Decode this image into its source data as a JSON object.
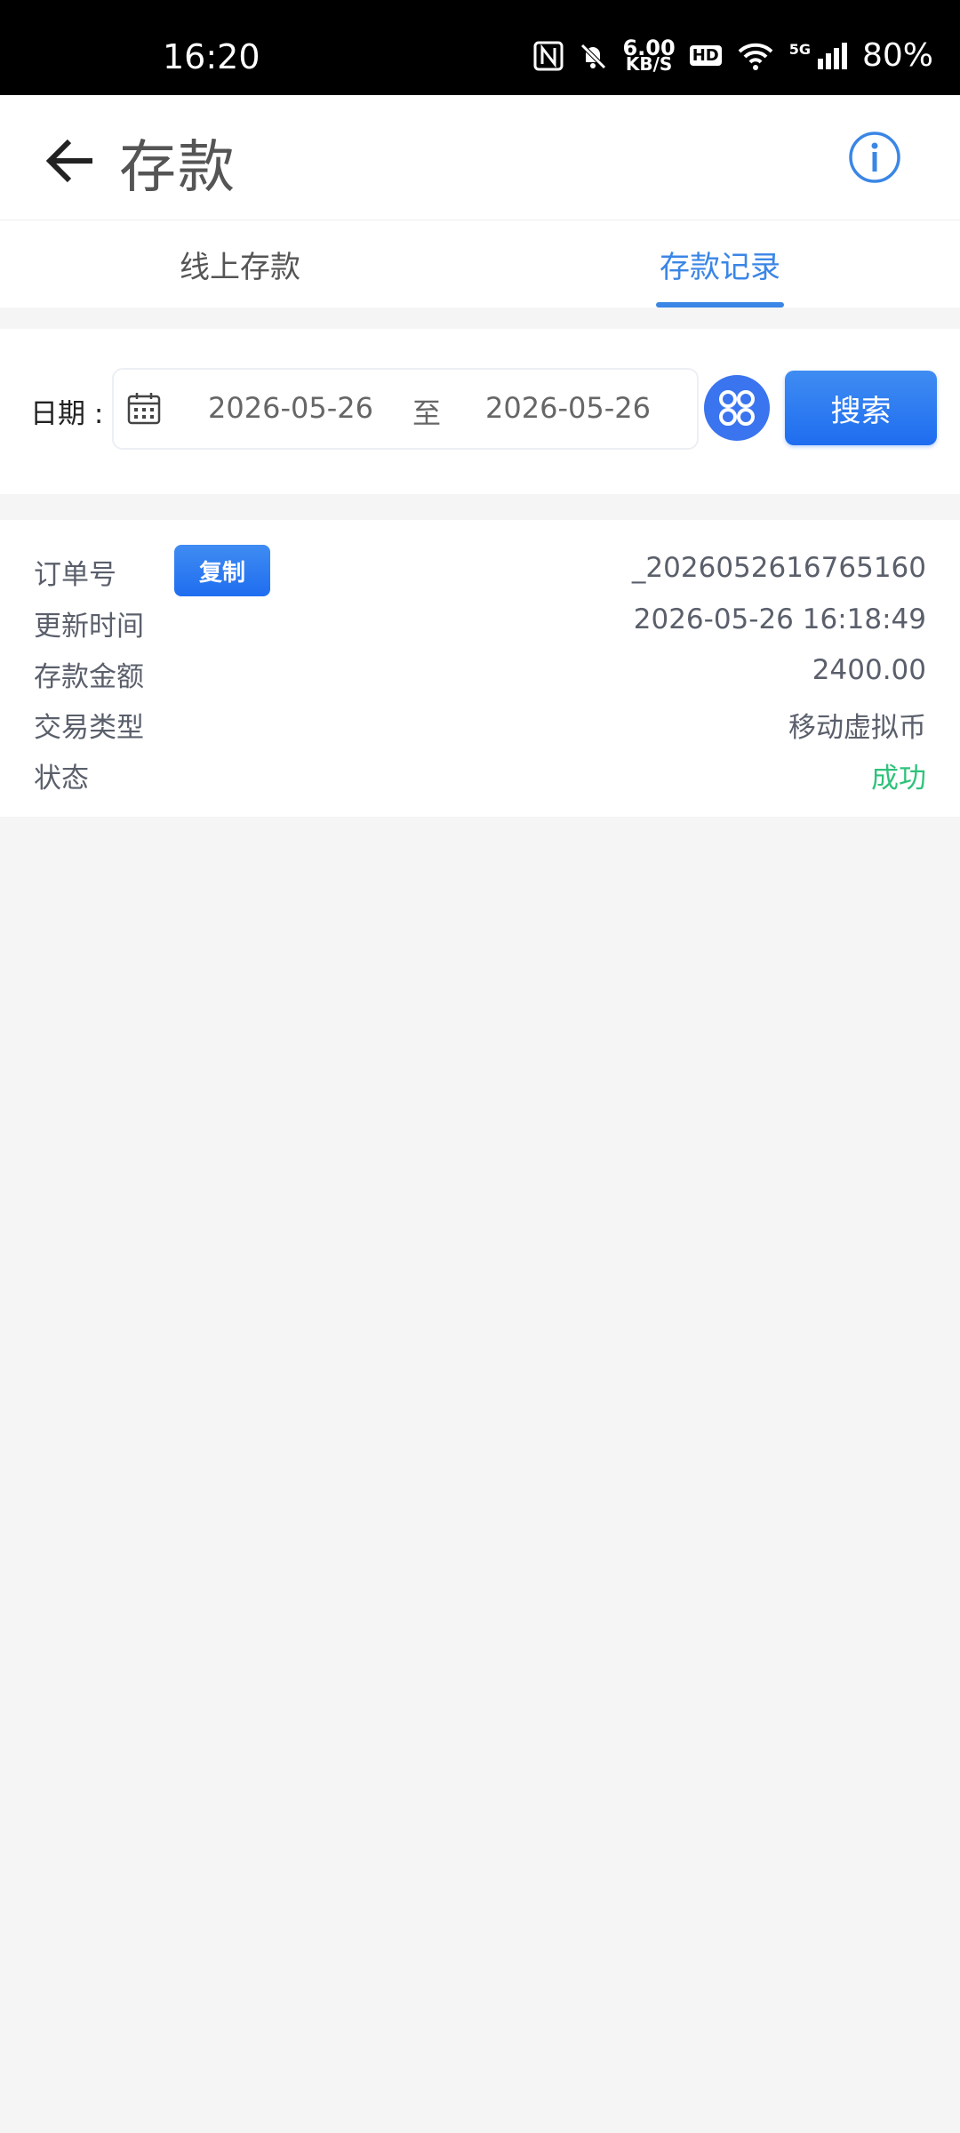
{
  "status_bar": {
    "time": "16:20",
    "speed_value": "6.00",
    "speed_unit": "KB/S",
    "hd_label": "HD",
    "network_label": "5G",
    "battery": "80%"
  },
  "header": {
    "title": "存款"
  },
  "tabs": [
    {
      "label": "线上存款",
      "active": false
    },
    {
      "label": "存款记录",
      "active": true
    }
  ],
  "filter": {
    "date_label": "日期 :",
    "start_date": "2026-05-26",
    "separator": "至",
    "end_date": "2026-05-26",
    "search_label": "搜索"
  },
  "record": {
    "copy_label": "复制",
    "rows": [
      {
        "label": "订单号",
        "value": "_2026052616765160"
      },
      {
        "label": "更新时间",
        "value": "2026-05-26 16:18:49"
      },
      {
        "label": "存款金额",
        "value": "2400.00"
      },
      {
        "label": "交易类型",
        "value": "移动虚拟币"
      },
      {
        "label": "状态",
        "value": "成功"
      }
    ]
  },
  "colors": {
    "accent": "#3a86e6",
    "success": "#2fc27b",
    "background": "#f5f5f5"
  },
  "icons": [
    "back-arrow-icon",
    "info-icon",
    "calendar-icon",
    "quick-filter-icon",
    "nfc-icon",
    "bell-off-icon",
    "wifi-icon",
    "signal-icon"
  ]
}
